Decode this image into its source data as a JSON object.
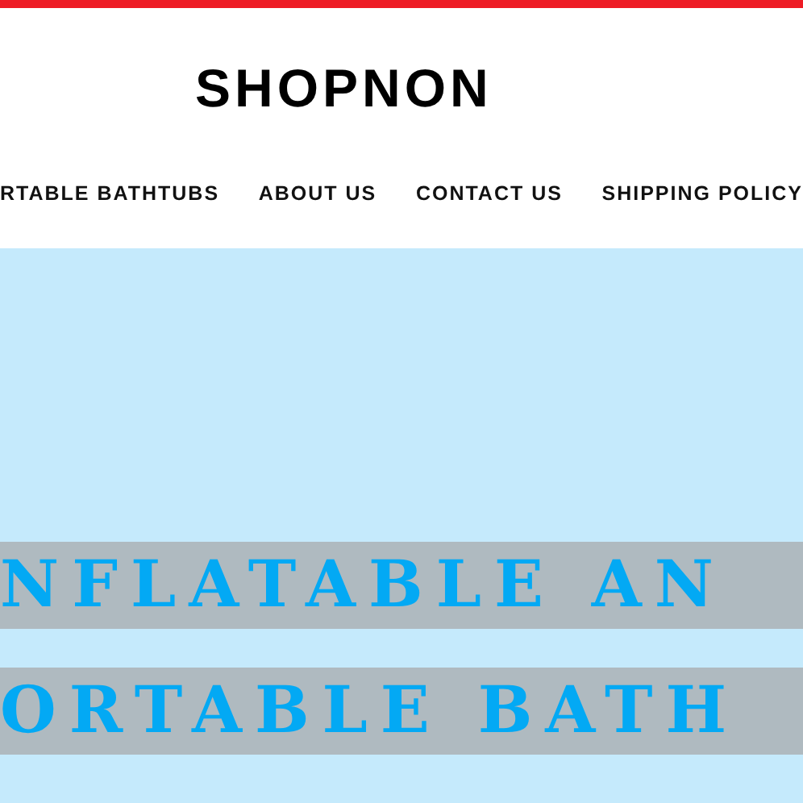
{
  "logo": "SHOPNON",
  "nav": [
    {
      "label": "RTABLE BATHTUBS"
    },
    {
      "label": "ABOUT US"
    },
    {
      "label": "CONTACT US"
    },
    {
      "label": "SHIPPING POLICY"
    }
  ],
  "hero": {
    "lines": [
      "NFLATABLE AN",
      "ORTABLE BATH"
    ]
  }
}
